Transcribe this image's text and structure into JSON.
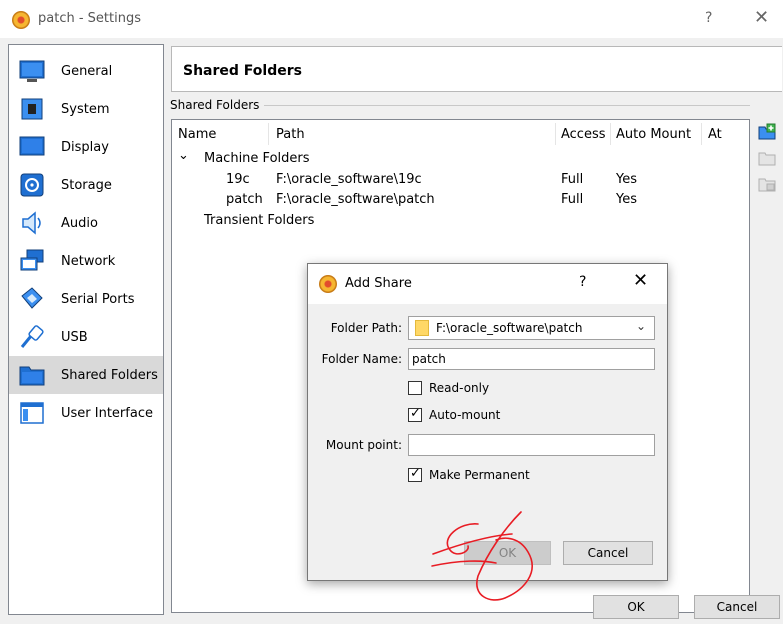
{
  "window": {
    "title": "patch - Settings",
    "help": "?",
    "close": "✕"
  },
  "sidebar": {
    "items": [
      {
        "label": "General",
        "icon": "general-icon"
      },
      {
        "label": "System",
        "icon": "system-icon"
      },
      {
        "label": "Display",
        "icon": "display-icon"
      },
      {
        "label": "Storage",
        "icon": "storage-icon"
      },
      {
        "label": "Audio",
        "icon": "audio-icon"
      },
      {
        "label": "Network",
        "icon": "network-icon"
      },
      {
        "label": "Serial Ports",
        "icon": "serial-ports-icon"
      },
      {
        "label": "USB",
        "icon": "usb-icon"
      },
      {
        "label": "Shared Folders",
        "icon": "shared-folders-icon",
        "selected": true
      },
      {
        "label": "User Interface",
        "icon": "user-interface-icon"
      }
    ]
  },
  "page": {
    "header": "Shared Folders",
    "group_label": "Shared Folders",
    "columns": {
      "name": "Name",
      "path": "Path",
      "access": "Access",
      "auto_mount": "Auto Mount",
      "at": "At"
    },
    "machine_folders": {
      "label": "Machine Folders",
      "expander": "⌄",
      "rows": [
        {
          "name": "19c",
          "path": "F:\\oracle_software\\19c",
          "access": "Full",
          "auto_mount": "Yes"
        },
        {
          "name": "patch",
          "path": "F:\\oracle_software\\patch",
          "access": "Full",
          "auto_mount": "Yes"
        }
      ]
    },
    "transient_folders": {
      "label": "Transient Folders"
    }
  },
  "footer": {
    "ok": "OK",
    "cancel": "Cancel"
  },
  "dialog": {
    "title": "Add Share",
    "help": "?",
    "close": "✕",
    "folder_path_label": "Folder Path:",
    "folder_path_value": "F:\\oracle_software\\patch",
    "folder_name_label": "Folder Name:",
    "folder_name_value": "patch",
    "read_only": {
      "label": "Read-only",
      "checked": false
    },
    "auto_mount": {
      "label": "Auto-mount",
      "checked": true
    },
    "mount_point_label": "Mount point:",
    "mount_point_value": "",
    "make_permanent": {
      "label": "Make Permanent",
      "checked": true
    },
    "ok": "OK",
    "cancel": "Cancel"
  },
  "colors": {
    "selection": "#d9d9d9",
    "annotation": "#e81c24",
    "folder": "#ffd866"
  }
}
